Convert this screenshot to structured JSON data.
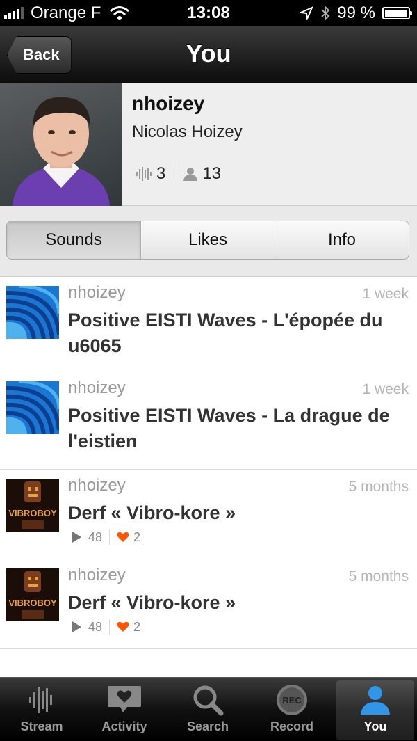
{
  "status_bar": {
    "carrier": "Orange F",
    "time": "13:08",
    "battery": "99 %"
  },
  "nav": {
    "back_label": "Back",
    "title": "You"
  },
  "profile": {
    "username": "nhoizey",
    "full_name": "Nicolas Hoizey",
    "sounds_count": "3",
    "followers_count": "13"
  },
  "tabs": [
    {
      "label": "Sounds",
      "active": true
    },
    {
      "label": "Likes",
      "active": false
    },
    {
      "label": "Info",
      "active": false
    }
  ],
  "items": [
    {
      "user": "nhoizey",
      "time": "1 week",
      "title": "Positive EISTI Waves - L'épopée du u6065",
      "artwork": "eisti-waves-artwork"
    },
    {
      "user": "nhoizey",
      "time": "1 week",
      "title": "Positive EISTI Waves - La drague de l'eistien",
      "artwork": "eisti-waves-artwork"
    },
    {
      "user": "nhoizey",
      "time": "5 months",
      "title": "Derf « Vibro-kore »",
      "artwork": "vibroboy-artwork",
      "artwork_text": "VIBROBOY",
      "plays": "48",
      "likes": "2"
    },
    {
      "user": "nhoizey",
      "time": "5 months",
      "title": "Derf « Vibro-kore »",
      "artwork": "vibroboy-artwork",
      "artwork_text": "VIBROBOY",
      "plays": "48",
      "likes": "2"
    }
  ],
  "tabbar": [
    {
      "label": "Stream",
      "icon": "waveform-icon"
    },
    {
      "label": "Activity",
      "icon": "heart-bubble-icon"
    },
    {
      "label": "Search",
      "icon": "magnifier-icon"
    },
    {
      "label": "Record",
      "icon": "rec-icon",
      "icon_text": "REC"
    },
    {
      "label": "You",
      "icon": "person-icon",
      "active": true
    }
  ],
  "colors": {
    "accent_blue": "#1f8fe0",
    "like_orange": "#ff5500"
  }
}
